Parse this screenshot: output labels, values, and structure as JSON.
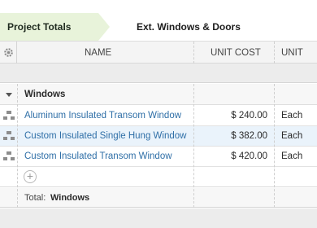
{
  "breadcrumb": {
    "items": [
      {
        "label": "Project Totals"
      },
      {
        "label": "Ext. Windows & Doors"
      }
    ]
  },
  "table": {
    "headers": {
      "name": "NAME",
      "unit_cost": "UNIT COST",
      "unit": "UNIT"
    },
    "group": {
      "label": "Windows"
    },
    "rows": [
      {
        "name": "Aluminum Insulated Transom Window",
        "unit_cost": "$ 240.00",
        "unit": "Each",
        "selected": false
      },
      {
        "name": "Custom Insulated Single Hung Window",
        "unit_cost": "$ 382.00",
        "unit": "Each",
        "selected": true
      },
      {
        "name": "Custom Insulated Transom Window",
        "unit_cost": "$ 420.00",
        "unit": "Each",
        "selected": false
      }
    ],
    "add_symbol": "+",
    "total": {
      "prefix": "Total:",
      "label": "Windows"
    }
  },
  "colors": {
    "breadcrumb_active": "#e8f3da",
    "link": "#2f6fa7",
    "selected_row": "#eaf3fb"
  }
}
